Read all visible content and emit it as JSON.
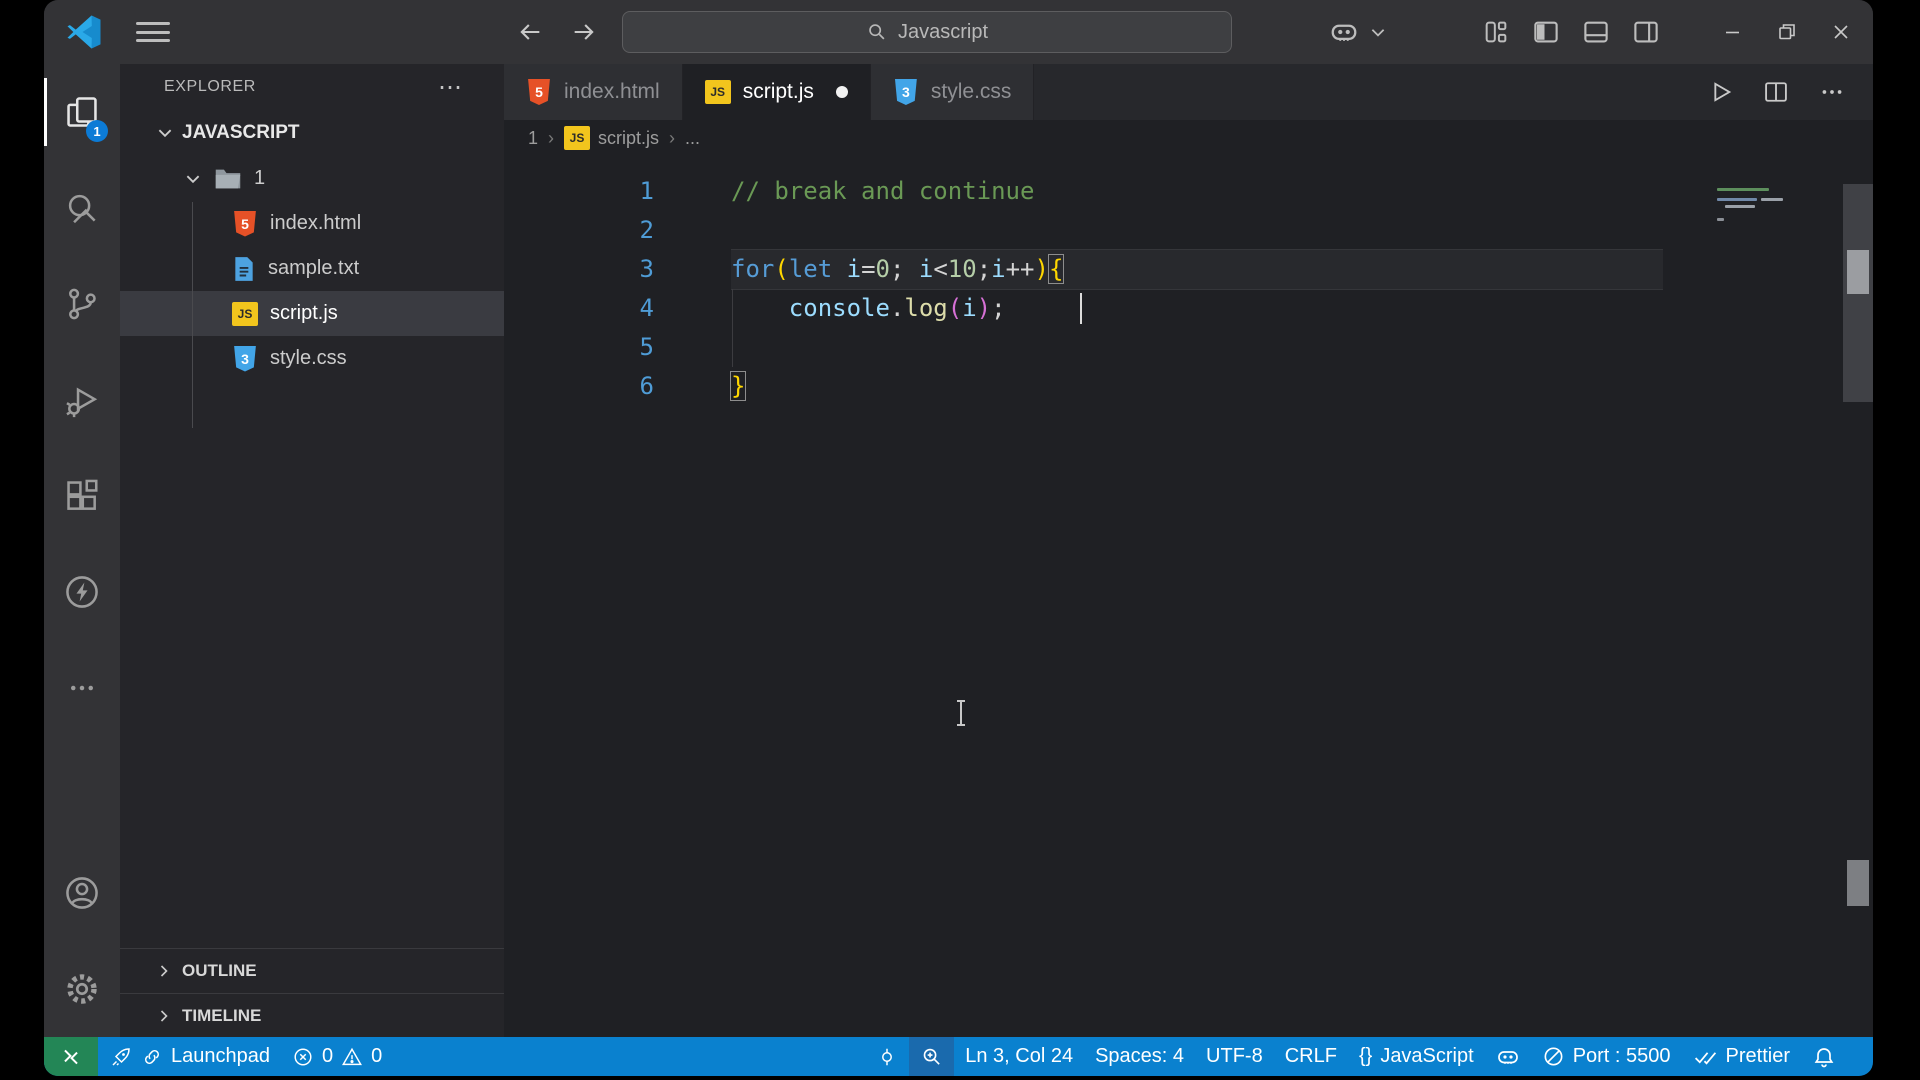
{
  "title_bar": {
    "search_placeholder": "Javascript"
  },
  "activity_bar": {
    "badge": "1",
    "items": [
      "explorer",
      "search",
      "source-control",
      "run-and-debug",
      "extensions",
      "live-server",
      "more-actions",
      "accounts",
      "settings"
    ]
  },
  "explorer": {
    "title": "EXPLORER",
    "actions": "⋯",
    "root": "JAVASCRIPT",
    "folder": "1",
    "files": [
      {
        "name": "index.html",
        "icon": "html",
        "selected": false
      },
      {
        "name": "sample.txt",
        "icon": "txt",
        "selected": false
      },
      {
        "name": "script.js",
        "icon": "js",
        "selected": true
      },
      {
        "name": "style.css",
        "icon": "css",
        "selected": false
      }
    ],
    "sections": [
      {
        "label": "OUTLINE"
      },
      {
        "label": "TIMELINE"
      }
    ]
  },
  "tabs": [
    {
      "label": "index.html",
      "icon": "html",
      "active": false,
      "modified": false
    },
    {
      "label": "script.js",
      "icon": "js",
      "active": true,
      "modified": true
    },
    {
      "label": "style.css",
      "icon": "css",
      "active": false,
      "modified": false
    }
  ],
  "breadcrumb": {
    "items": [
      {
        "label": "1"
      },
      {
        "label": "script.js",
        "icon": "js"
      },
      {
        "label": "..."
      }
    ]
  },
  "editor": {
    "token_colors": {
      "comment": "#6A9955",
      "keyword": "#569CD6",
      "variable": "#9CDCFE",
      "plain": "#D4D4D4",
      "number": "#B5CEA8",
      "bracket1": "#FFD700",
      "bracket2": "#D670D6",
      "method": "#DCDCAA"
    },
    "lines": [
      {
        "n": "1",
        "tokens": [
          {
            "t": "// break and continue",
            "c": "comment"
          }
        ]
      },
      {
        "n": "2",
        "tokens": []
      },
      {
        "n": "3",
        "current": true,
        "tokens": [
          {
            "t": "for",
            "c": "keyword"
          },
          {
            "t": "(",
            "c": "bracket1"
          },
          {
            "t": "let",
            "c": "keyword"
          },
          {
            "t": " ",
            "c": "plain"
          },
          {
            "t": "i",
            "c": "variable"
          },
          {
            "t": "=",
            "c": "plain"
          },
          {
            "t": "0",
            "c": "number"
          },
          {
            "t": "; ",
            "c": "plain"
          },
          {
            "t": "i",
            "c": "variable"
          },
          {
            "t": "<",
            "c": "plain"
          },
          {
            "t": "10",
            "c": "number"
          },
          {
            "t": ";",
            "c": "plain"
          },
          {
            "t": "i",
            "c": "variable"
          },
          {
            "t": "++",
            "c": "plain"
          },
          {
            "t": ")",
            "c": "bracket1"
          },
          {
            "t": "{",
            "c": "bracket1",
            "box": true
          }
        ]
      },
      {
        "n": "4",
        "tokens": [
          {
            "t": "    ",
            "c": "plain"
          },
          {
            "t": "console",
            "c": "variable"
          },
          {
            "t": ".",
            "c": "plain"
          },
          {
            "t": "log",
            "c": "method"
          },
          {
            "t": "(",
            "c": "bracket2"
          },
          {
            "t": "i",
            "c": "variable"
          },
          {
            "t": ")",
            "c": "bracket2"
          },
          {
            "t": ";",
            "c": "plain"
          }
        ]
      },
      {
        "n": "5",
        "tokens": []
      },
      {
        "n": "6",
        "tokens": [
          {
            "t": "}",
            "c": "bracket1",
            "box": true
          }
        ]
      }
    ]
  },
  "status_bar": {
    "launchpad": "Launchpad",
    "errors": "0",
    "warnings": "0",
    "cursor_position": "Ln 3, Col 24",
    "indentation": "Spaces: 4",
    "encoding": "UTF-8",
    "eol": "CRLF",
    "language_braces": "{}",
    "language": "JavaScript",
    "port": "Port : 5500",
    "prettier": "Prettier"
  },
  "colors": {
    "statusbar_blue": "#0a81cf",
    "remote_green": "#238656",
    "accent_blue": "#0c7bd6",
    "titlebar": "#333336",
    "sidebar": "#252529",
    "editor": "#1f2024"
  }
}
